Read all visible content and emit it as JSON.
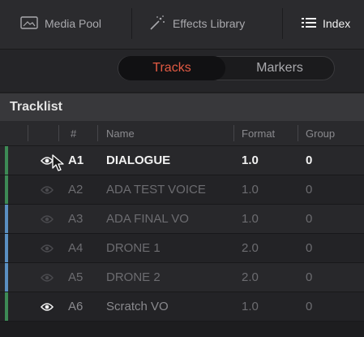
{
  "tabs": [
    {
      "label": "Media Pool",
      "icon": "media-pool-icon"
    },
    {
      "label": "Effects Library",
      "icon": "effects-wand-icon"
    },
    {
      "label": "Index",
      "icon": "index-list-icon"
    }
  ],
  "segment": {
    "active": "Tracks",
    "inactive": "Markers"
  },
  "section_title": "Tracklist",
  "columns": {
    "num": "#",
    "name": "Name",
    "format": "Format",
    "group": "Group"
  },
  "colors": {
    "accent": "#e25a43",
    "stripe_green": "#3d8a55",
    "stripe_blue": "#5a8fc2"
  },
  "rows": [
    {
      "id": "A1",
      "name": "DIALOGUE",
      "format": "1.0",
      "group": "0",
      "eye_on": true,
      "highlight": true,
      "stripe": "green"
    },
    {
      "id": "A2",
      "name": "ADA TEST VOICE",
      "format": "1.0",
      "group": "0",
      "eye_on": false,
      "highlight": false,
      "stripe": "green"
    },
    {
      "id": "A3",
      "name": "ADA FINAL VO",
      "format": "1.0",
      "group": "0",
      "eye_on": false,
      "highlight": false,
      "stripe": "blue"
    },
    {
      "id": "A4",
      "name": "DRONE 1",
      "format": "2.0",
      "group": "0",
      "eye_on": false,
      "highlight": false,
      "stripe": "blue"
    },
    {
      "id": "A5",
      "name": "DRONE 2",
      "format": "2.0",
      "group": "0",
      "eye_on": false,
      "highlight": false,
      "stripe": "blue"
    },
    {
      "id": "A6",
      "name": "Scratch VO",
      "format": "1.0",
      "group": "0",
      "eye_on": true,
      "highlight": false,
      "stripe": "green"
    }
  ]
}
